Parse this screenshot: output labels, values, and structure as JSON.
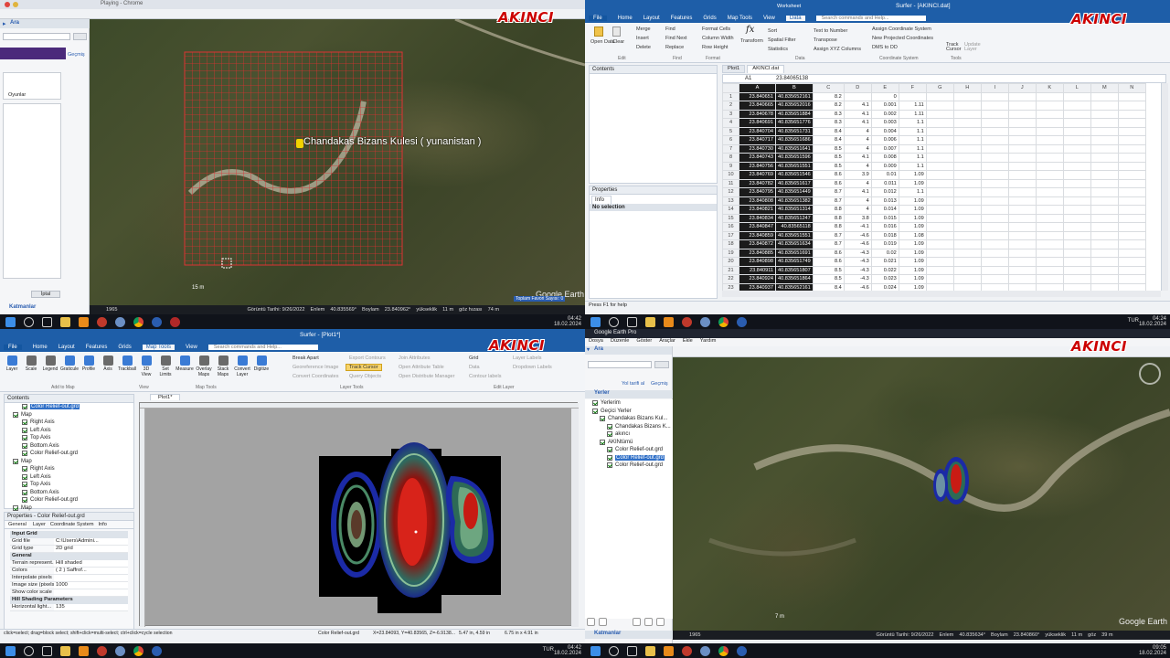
{
  "brand": {
    "logo_text": "AKINCI"
  },
  "q1": {
    "title": "Playing - Chrome",
    "search_label": "Ara",
    "history_label": "Geçmiş",
    "places_label": "Oyunlar",
    "cancel": "İptal",
    "placemark_label": "Chandakas Bizans Kulesi ( yunanistan )",
    "scale": "15 m",
    "status": {
      "year": "1965",
      "image_date": "Görüntü Tarihi: 9/26/2022",
      "lat_label": "Enlem",
      "lat": "40.835569°",
      "lon_label": "Boylam",
      "lon": "23.840962°",
      "elev_label": "yükseklik",
      "elev": "11 m",
      "eye_label": "göz hızası",
      "eye": "74 m"
    },
    "watermark": "Google Earth",
    "layers_label": "Katmanlar",
    "tour": "Toplam Favori Sayısı: 0"
  },
  "q2": {
    "title": "Surfer - [AKINCI.dat]",
    "context_tab": "Worksheet",
    "tabs": [
      "File",
      "Home",
      "Layout",
      "Features",
      "Grids",
      "Map Tools",
      "View",
      "Data"
    ],
    "active_tab": "Data",
    "search_placeholder": "Search commands and Help...",
    "groups": {
      "file": [
        "Open Data",
        "Clear",
        "Delete"
      ],
      "edit": [
        "Merge",
        "Insert",
        "Delete"
      ],
      "find": [
        "Find",
        "Find Next",
        "Replace"
      ],
      "format": [
        "Format Cells",
        "Column Width",
        "Row Height"
      ],
      "data": [
        "Transform",
        "Sort",
        "Spatial Filter",
        "Statistics",
        "Text to Number",
        "Transpose",
        "Assign XYZ Columns"
      ],
      "coords": [
        "Assign Coordinate System",
        "New Projected Coordinates",
        "DMS to DD"
      ],
      "tools": [
        "Track Cursor",
        "Update Layer"
      ]
    },
    "group_labels": [
      "Edit",
      "Find",
      "Format",
      "Data",
      "Coordinate System",
      "Tools"
    ],
    "contents_label": "Contents",
    "properties_label": "Properties",
    "info_tab": "Info",
    "no_selection": "No selection",
    "doc_tabs": [
      "Plot1",
      "AKINCI.dat"
    ],
    "cell_ref": "A1",
    "formula": "23.84065138",
    "columns": [
      "A",
      "B",
      "C",
      "D",
      "E",
      "F",
      "G",
      "H",
      "I",
      "J",
      "K",
      "L",
      "M",
      "N"
    ],
    "rows": [
      [
        "23.840651",
        "40.835652161",
        "8.2",
        "",
        "0",
        ""
      ],
      [
        "23.840665",
        "40.835652016",
        "8.2",
        "4.1",
        "0.001",
        "1.11"
      ],
      [
        "23.840678",
        "40.835651884",
        "8.3",
        "4.1",
        "0.002",
        "1.11"
      ],
      [
        "23.840691",
        "40.835651776",
        "8.3",
        "4.1",
        "0.003",
        "1.1"
      ],
      [
        "23.840704",
        "40.835651731",
        "8.4",
        "4",
        "0.004",
        "1.1"
      ],
      [
        "23.840717",
        "40.835651686",
        "8.4",
        "4",
        "0.006",
        "1.1"
      ],
      [
        "23.840730",
        "40.835651641",
        "8.5",
        "4",
        "0.007",
        "1.1"
      ],
      [
        "23.840743",
        "40.835651596",
        "8.5",
        "4.1",
        "0.008",
        "1.1"
      ],
      [
        "23.840756",
        "40.835651551",
        "8.5",
        "4",
        "0.009",
        "1.1"
      ],
      [
        "23.840769",
        "40.835651546",
        "8.6",
        "3.9",
        "0.01",
        "1.09"
      ],
      [
        "23.840782",
        "40.835651617",
        "8.6",
        "4",
        "0.011",
        "1.09"
      ],
      [
        "23.840795",
        "40.835651449",
        "8.7",
        "4.1",
        "0.012",
        "1.1"
      ],
      [
        "23.840808",
        "40.835651382",
        "8.7",
        "4",
        "0.013",
        "1.09"
      ],
      [
        "23.840821",
        "40.835651314",
        "8.8",
        "4",
        "0.014",
        "1.09"
      ],
      [
        "23.840834",
        "40.835651247",
        "8.8",
        "3.8",
        "0.015",
        "1.09"
      ],
      [
        "23.840847",
        "40.83565118",
        "8.8",
        "-4.1",
        "0.016",
        "1.09"
      ],
      [
        "23.840859",
        "40.835651551",
        "8.7",
        "-4.6",
        "0.018",
        "1.08"
      ],
      [
        "23.840872",
        "40.835651634",
        "8.7",
        "-4.6",
        "0.019",
        "1.09"
      ],
      [
        "23.840885",
        "40.835651691",
        "8.6",
        "-4.3",
        "0.02",
        "1.09"
      ],
      [
        "23.840898",
        "40.835651749",
        "8.6",
        "-4.3",
        "0.021",
        "1.09"
      ],
      [
        "23.840911",
        "40.835651807",
        "8.5",
        "-4.3",
        "0.022",
        "1.09"
      ],
      [
        "23.840924",
        "40.835651864",
        "8.5",
        "-4.3",
        "0.023",
        "1.09"
      ],
      [
        "23.840937",
        "40.835652161",
        "8.4",
        "-4.6",
        "0.024",
        "1.09"
      ]
    ],
    "status": "Press F1 for help",
    "clock_time": "04:24",
    "clock_date": "18.02.2024",
    "lang": "TUR"
  },
  "q3": {
    "title": "Surfer - [Plot1*]",
    "tabs": [
      "File",
      "Home",
      "Layout",
      "Features",
      "Grids",
      "Map Tools",
      "View"
    ],
    "active_tab": "Map Tools",
    "search_placeholder": "Search commands and Help...",
    "tools": [
      "Layer",
      "Scale",
      "Legend",
      "Graticule",
      "Profile",
      "Axis",
      "Trackball",
      "3D View",
      "Set Limits",
      "Measure",
      "Overlay Maps",
      "Stack Maps",
      "Convert Layer",
      "Digitize"
    ],
    "layer_tools": [
      "Break Apart",
      "Georeference Image",
      "Convert Coordinates",
      "Export Contours",
      "Track Cursor",
      "Query Objects",
      "Join Attributes",
      "Open Attribute Table",
      "Open Distribute Manager"
    ],
    "edit_layer": [
      "Grid",
      "Data",
      "Contour labels",
      "Layer Labels",
      "Dropdown Labels"
    ],
    "group_labels": [
      "Add to Map",
      "View",
      "Map Tools",
      "Layer Tools",
      "Edit Layer"
    ],
    "contents_label": "Contents",
    "tree": [
      {
        "label": "Color Relief-out.grd",
        "level": 1,
        "selected": true
      },
      {
        "label": "Map",
        "level": 0
      },
      {
        "label": "Right Axis",
        "level": 1
      },
      {
        "label": "Left Axis",
        "level": 1
      },
      {
        "label": "Top Axis",
        "level": 1
      },
      {
        "label": "Bottom Axis",
        "level": 1
      },
      {
        "label": "Color Relief-out.grd",
        "level": 1
      },
      {
        "label": "Map",
        "level": 0
      },
      {
        "label": "Right Axis",
        "level": 1
      },
      {
        "label": "Left Axis",
        "level": 1
      },
      {
        "label": "Top Axis",
        "level": 1
      },
      {
        "label": "Bottom Axis",
        "level": 1
      },
      {
        "label": "Color Relief-out.grd",
        "level": 1
      },
      {
        "label": "Map",
        "level": 0
      }
    ],
    "properties_label": "Properties - Color Relief-out.grd",
    "prop_tabs": [
      "General",
      "Layer",
      "Coordinate System",
      "Info"
    ],
    "props": [
      {
        "head": "Input Grid"
      },
      {
        "k": "Grid file",
        "v": "C:\\Users\\Admini..."
      },
      {
        "k": "Grid type",
        "v": "2D grid"
      },
      {
        "head": "General"
      },
      {
        "k": "Terrain represent...",
        "v": "Hill shaded"
      },
      {
        "k": "Colors",
        "v": "( 2 ) Saffrof..."
      },
      {
        "k": "Interpolate pixels",
        "v": ""
      },
      {
        "k": "Image size (pixels)",
        "v": "1000"
      },
      {
        "k": "Show color scale",
        "v": ""
      },
      {
        "head": "Hill Shading Parameters"
      },
      {
        "k": "Horizontal light...",
        "v": "135"
      }
    ],
    "doc_tab": "Plot1*",
    "status": {
      "hint": "click=select; drag=block select; shift+click=multi-select; ctrl+click=cycle selection",
      "layer": "Color Relief-out.grd",
      "coords": "X=23.84093, Y=40.83565, Z=-6.9138...",
      "size": "5.47 in, 4.59 in",
      "dims": "6.75 in x 4.91 in"
    }
  },
  "q4": {
    "title": "Google Earth Pro",
    "menu": [
      "Dosya",
      "Düzenle",
      "Göster",
      "Araçlar",
      "Ekle",
      "Yardım"
    ],
    "search_label": "Ara",
    "route_label": "Yol tarifi al",
    "history_label": "Geçmiş",
    "places_header": "Yerler",
    "tree": [
      {
        "label": "Yerlerim",
        "level": 0
      },
      {
        "label": "Geçici Yerler",
        "level": 0
      },
      {
        "label": "Chandakas Bizans Kul...",
        "level": 1
      },
      {
        "label": "Chandakas Bizans K...",
        "level": 2
      },
      {
        "label": "akıncı",
        "level": 2
      },
      {
        "label": "AKINtümü",
        "level": 1
      },
      {
        "label": "Color Relief-out.grd",
        "level": 2
      },
      {
        "label": "Color Relief-out.grd",
        "level": 2,
        "selected": true
      },
      {
        "label": "Color Relief-out.grd",
        "level": 2
      }
    ],
    "layers_label": "Katmanlar",
    "scale": "7 m",
    "status": {
      "year": "1965",
      "image_date": "Görüntü Tarihi: 9/26/2022",
      "lat_label": "Enlem",
      "lat": "40.835634°",
      "lon_label": "Boylam",
      "lon": "23.840860°",
      "elev_label": "yükseklik",
      "elev": "11 m",
      "eye_label": "göz",
      "eye": "39 m"
    },
    "watermark": "Google Earth",
    "clock_time": "09:05",
    "clock_date": "18.02.2024"
  },
  "taskbar_left": {
    "clock_time": "04:42",
    "clock_date": "18.02.2024",
    "lang": "TUR"
  },
  "taskbar_bottom": {
    "clock_time": "04:42",
    "clock_date": "18.02.2024",
    "lang": "TUR"
  }
}
